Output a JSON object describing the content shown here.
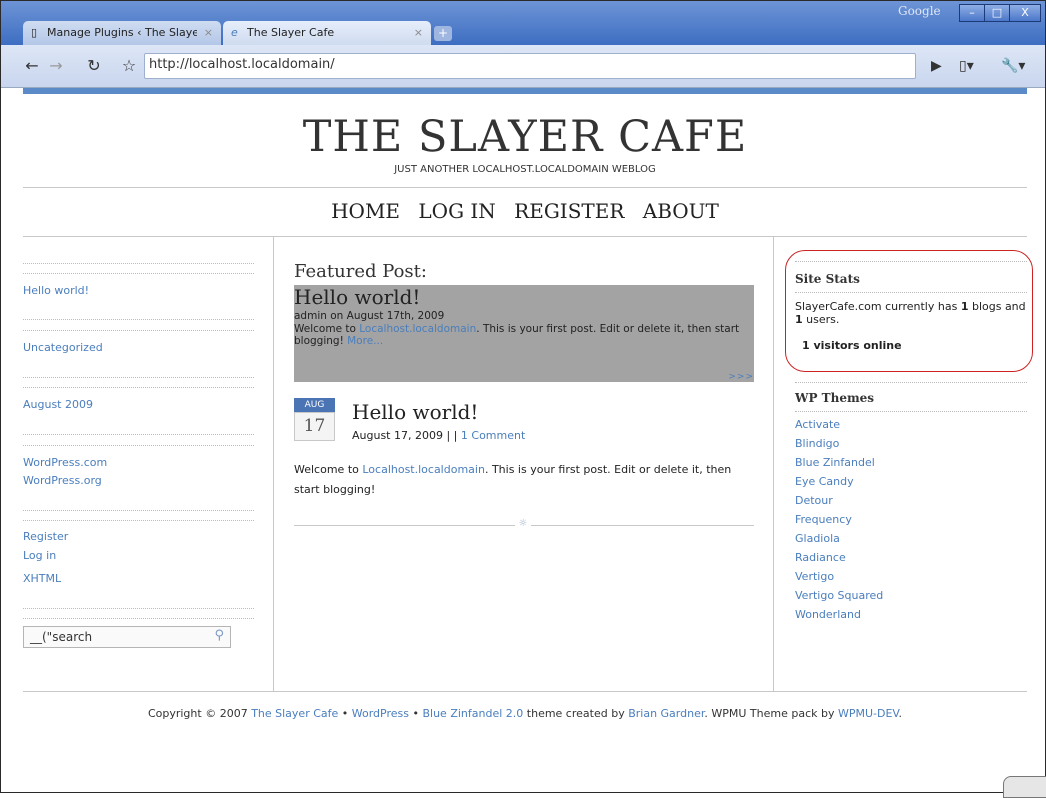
{
  "browser": {
    "tabs": [
      {
        "label": "Manage Plugins ‹ The Slaye…",
        "close": "×"
      },
      {
        "label": "The Slayer Cafe",
        "close": "×"
      }
    ],
    "new_tab": "+",
    "brand": "Google",
    "window_buttons": [
      "–",
      "□",
      "X"
    ],
    "url": "http://localhost.localdomain/"
  },
  "site": {
    "title": "THE SLAYER CAFE",
    "tagline": "JUST ANOTHER LOCALHOST.LOCALDOMAIN WEBLOG",
    "nav": [
      "HOME",
      "LOG IN",
      "REGISTER",
      "ABOUT"
    ]
  },
  "left_sidebar": {
    "recent_post": "Hello world!",
    "category": "Uncategorized",
    "archive": "August 2009",
    "links": [
      "WordPress.com",
      "WordPress.org"
    ],
    "meta": [
      "Register",
      "Log in",
      "XHTML"
    ],
    "search_placeholder": "__(\"search"
  },
  "featured": {
    "heading": "Featured Post:",
    "title": "Hello world!",
    "meta": "admin on August 17th, 2009",
    "body_before": "Welcome to ",
    "body_link": "Localhost.localdomain",
    "body_after": ". This is your first post. Edit or delete it, then start blogging! ",
    "more": "More...",
    "next": ">>>"
  },
  "post": {
    "month": "AUG",
    "day": "17",
    "title": "Hello world!",
    "date": "August 17, 2009 | | ",
    "comments": "1 Comment",
    "body_before": "Welcome to ",
    "body_link": "Localhost.localdomain",
    "body_after": ". This is your first post. Edit or delete it, then start blogging!"
  },
  "right_sidebar": {
    "stats_title": "Site Stats",
    "stats_text_1": "SlayerCafe.com currently has ",
    "stats_blogs": "1",
    "stats_text_2": " blogs and ",
    "stats_users": "1",
    "stats_text_3": " users.",
    "visitors": "1 visitors online",
    "themes_title": "WP Themes",
    "themes": [
      "Activate",
      "Blindigo",
      "Blue Zinfandel",
      "Eye Candy",
      "Detour",
      "Frequency",
      "Gladiola",
      "Radiance",
      "Vertigo",
      "Vertigo Squared",
      "Wonderland"
    ]
  },
  "footer": {
    "t1": "Copyright © 2007 ",
    "l1": "The Slayer Cafe",
    "t2": " • ",
    "l2": "WordPress",
    "t3": " • ",
    "l3": "Blue Zinfandel 2.0",
    "t4": " theme created by ",
    "l4": "Brian Gardner",
    "t5": ". WPMU Theme pack by ",
    "l5": "WPMU-DEV",
    "t6": "."
  },
  "colors": {
    "link": "#4a7ebd",
    "accent": "#5a8ac7",
    "highlight": "#cc2222"
  }
}
